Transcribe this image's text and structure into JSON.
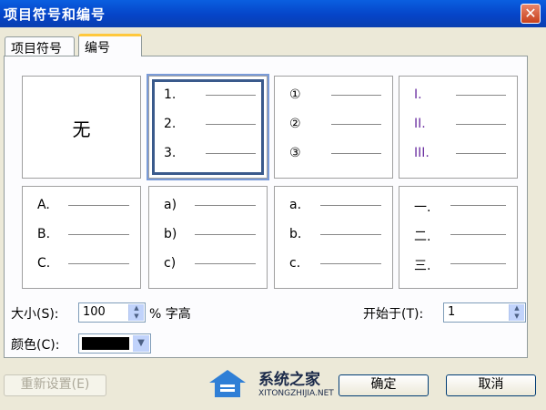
{
  "window": {
    "title": "项目符号和编号",
    "close_glyph": "✕"
  },
  "tabs": [
    {
      "label": "项目符号"
    },
    {
      "label": "编号"
    }
  ],
  "gallery": {
    "none_label": "无",
    "cells": [
      {
        "markers": [
          "1.",
          "2.",
          "3."
        ]
      },
      {
        "markers": [
          "①",
          "②",
          "③"
        ]
      },
      {
        "markers": [
          "I.",
          "II.",
          "III."
        ]
      },
      {
        "markers": [
          "A.",
          "B.",
          "C."
        ]
      },
      {
        "markers": [
          "a)",
          "b)",
          "c)"
        ]
      },
      {
        "markers": [
          "a.",
          "b.",
          "c."
        ]
      },
      {
        "markers": [
          "一.",
          "二.",
          "三."
        ]
      }
    ]
  },
  "size": {
    "label": "大小(S):",
    "value": "100",
    "unit": "% 字高"
  },
  "start": {
    "label": "开始于(T):",
    "value": "1"
  },
  "color": {
    "label": "颜色(C):",
    "value": "#000000"
  },
  "buttons": {
    "reset": "重新设置(E)",
    "ok": "确定",
    "cancel": "取消"
  },
  "watermark": {
    "text": "系统之家",
    "url": "XITONGZHIJIA.NET"
  }
}
